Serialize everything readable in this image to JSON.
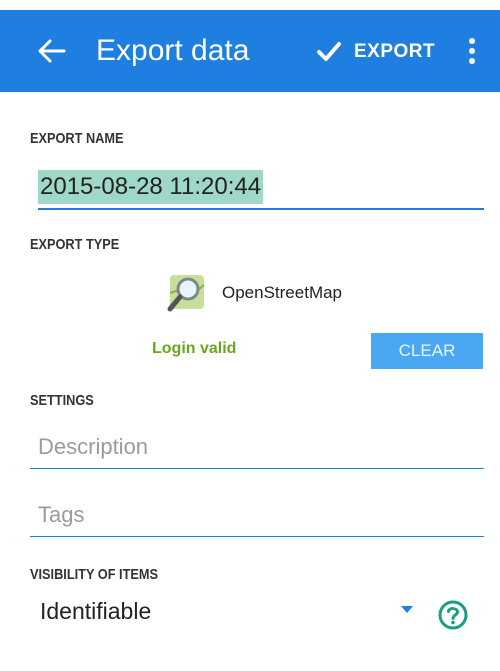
{
  "toolbar": {
    "title": "Export data",
    "export_label": "EXPORT",
    "accent_color": "#1f7fe0"
  },
  "export_name": {
    "label": "EXPORT NAME",
    "value": "2015-08-28 11:20:44"
  },
  "export_type": {
    "label": "EXPORT TYPE",
    "service": "OpenStreetMap",
    "login_status": "Login valid",
    "clear_label": "CLEAR"
  },
  "settings": {
    "label": "SETTINGS",
    "description_placeholder": "Description",
    "tags_placeholder": "Tags"
  },
  "visibility": {
    "label": "VISIBILITY OF ITEMS",
    "value": "Identifiable"
  },
  "icons": [
    "back-arrow-icon",
    "check-icon",
    "overflow-menu-icon",
    "osm-map-icon",
    "chevron-down-icon",
    "help-icon"
  ]
}
